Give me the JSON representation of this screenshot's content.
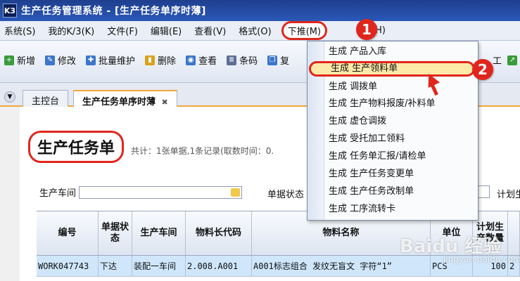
{
  "window": {
    "icon_text": "K3",
    "title": "生产任务管理系统 - [生产任务单序时薄]"
  },
  "menubar": {
    "items": [
      {
        "label": "系统(S)"
      },
      {
        "label": "我的K/3(K)"
      },
      {
        "label": "文件(F)"
      },
      {
        "label": "编辑(E)"
      },
      {
        "label": "查看(V)"
      },
      {
        "label": "格式(O)"
      },
      {
        "label": "下推(M)"
      },
      {
        "label": "H)"
      }
    ]
  },
  "toolbar": {
    "items": [
      {
        "label": "新增",
        "icon": "add-icon",
        "color": "#3a9b3a"
      },
      {
        "label": "修改",
        "icon": "edit-icon",
        "color": "#3b76c9"
      },
      {
        "label": "批量维护",
        "icon": "wrench-icon",
        "color": "#3b76c9"
      },
      {
        "label": "删除",
        "icon": "delete-icon",
        "color": "#d9a21c"
      },
      {
        "label": "查看",
        "icon": "view-icon",
        "color": "#3b76c9"
      },
      {
        "label": "条码",
        "icon": "barcode-icon",
        "color": "#5b6f94"
      },
      {
        "label": "复",
        "icon": "copy-icon",
        "color": "#3b76c9"
      }
    ],
    "right_label": "工"
  },
  "tabs": {
    "home": "主控台",
    "current": "生产任务单序时薄",
    "close": "✖"
  },
  "content": {
    "page_title": "生产任务单",
    "summary": "共计：1张单据,1条记录(取数时间：0."
  },
  "filters": {
    "workshop_label": "生产车间",
    "status_label": "单据状态",
    "plan_label": "计划生"
  },
  "grid": {
    "headers": [
      "编号",
      "单据状态",
      "生产车间",
      "物料长代码",
      "物料名称",
      "单位",
      "计划生产数量"
    ],
    "rows": [
      [
        "WORK047743",
        "下达",
        "装配一车间",
        "2.008.A001",
        "A001标志组合 发纹无盲文 字符“1”",
        "PCS",
        "100",
        "2"
      ]
    ]
  },
  "dropdown": {
    "items": [
      {
        "label": "生成 产品入库"
      },
      {
        "label": "生成 生产领料单"
      },
      {
        "label": "生成 调拨单"
      },
      {
        "label": "生成 生产物料报废/补料单"
      },
      {
        "label": "生成 虚仓调拨"
      },
      {
        "label": "生成 受托加工领料"
      },
      {
        "label": "生成 任务单汇报/请检单"
      },
      {
        "label": "生成 生产任务变更单"
      },
      {
        "label": "生成 生产任务改制单"
      },
      {
        "label": "生成 工序流转卡"
      }
    ],
    "highlighted_index": 1
  },
  "markers": {
    "step1": "1",
    "step2": "2",
    "accent_color": "#e0261c"
  },
  "watermark": {
    "text": "Baidu 经验",
    "sub": "jingyan.baidu.com"
  }
}
